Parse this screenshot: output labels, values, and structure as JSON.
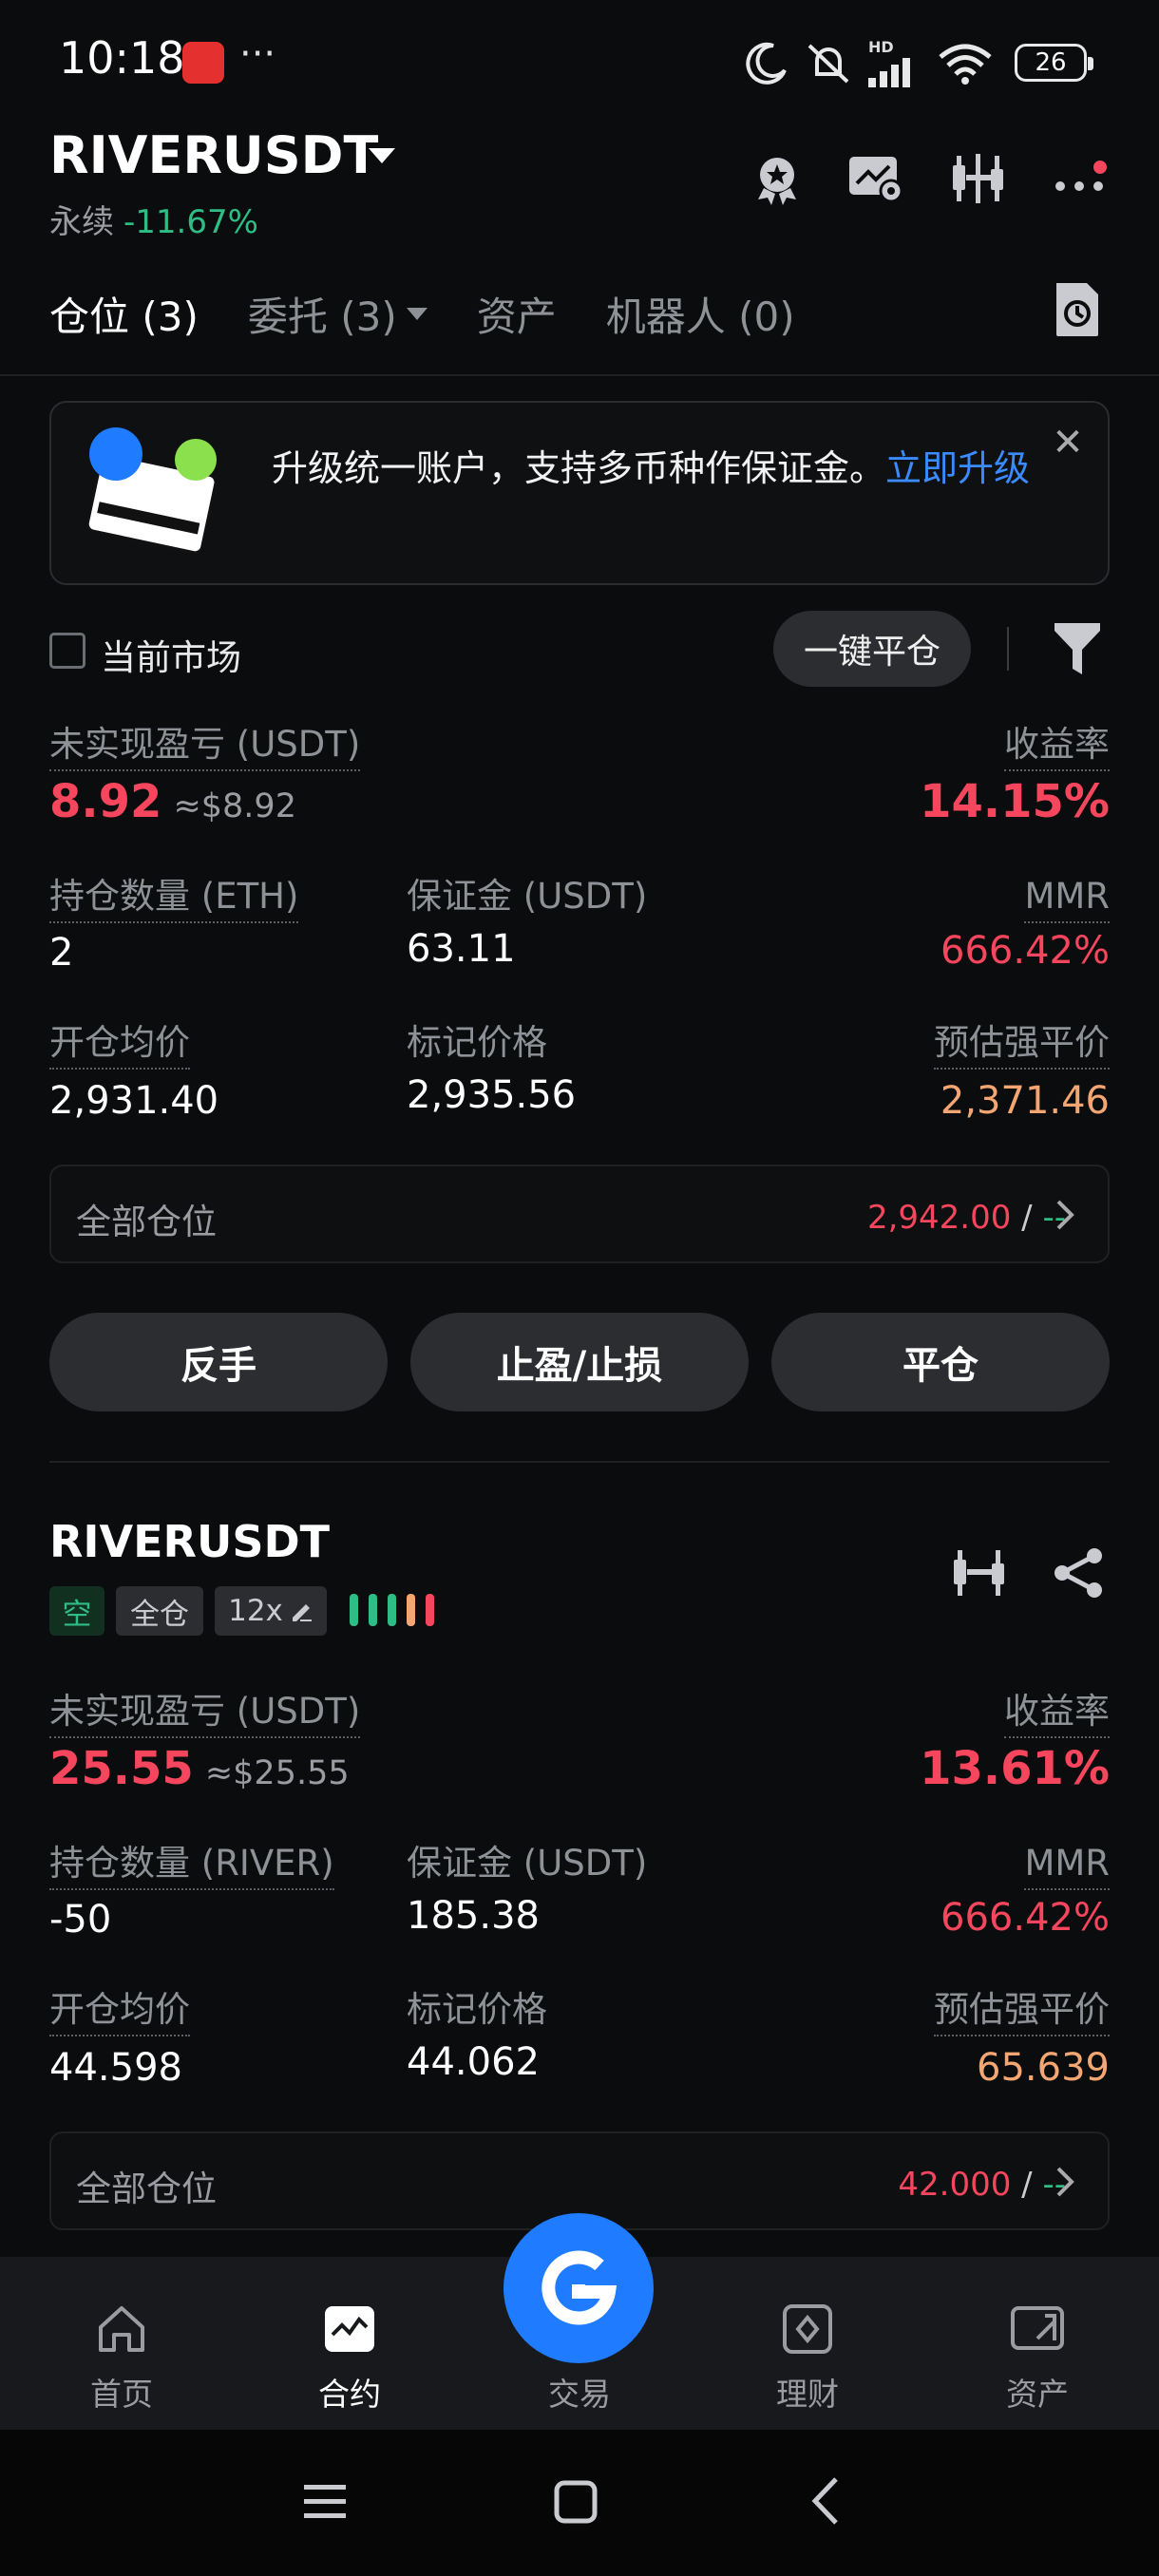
{
  "status_bar": {
    "time": "10:18",
    "more": "···",
    "battery": "26",
    "network": "HD"
  },
  "header": {
    "pair": "RIVERUSDT",
    "contract_type": "永续",
    "change": "-11.67%"
  },
  "tabs": [
    {
      "label": "仓位 (3)"
    },
    {
      "label": "委托 (3)"
    },
    {
      "label": "资产"
    },
    {
      "label": "机器人 (0)"
    }
  ],
  "banner": {
    "text": "升级统一账户，支持多币种作保证金。",
    "link": "立即升级",
    "close": "✕"
  },
  "filter": {
    "current_market_label": "当前市场",
    "close_all_label": "一键平仓"
  },
  "position1": {
    "pnl_label": "未实现盈亏 (USDT)",
    "pnl_value": "8.92",
    "pnl_approx": "≈$8.92",
    "roe_label": "收益率",
    "roe_value": "14.15%",
    "size_label": "持仓数量 (ETH)",
    "size_value": "2",
    "margin_label": "保证金 (USDT)",
    "margin_value": "63.11",
    "mmr_label": "MMR",
    "mmr_value": "666.42%",
    "entry_label": "开仓均价",
    "entry_value": "2,931.40",
    "mark_label": "标记价格",
    "mark_value": "2,935.56",
    "liq_label": "预估强平价",
    "liq_value": "2,371.46",
    "all_pos_label": "全部仓位",
    "all_pos_value": "2,942.00",
    "all_pos_slash": " / ",
    "all_pos_dash": "--"
  },
  "actions": {
    "reverse": "反手",
    "tpsl": "止盈/止损",
    "close": "平仓"
  },
  "position2": {
    "symbol": "RIVERUSDT",
    "side_tag": "空",
    "margin_mode_tag": "全仓",
    "leverage_tag": "12x",
    "pnl_label": "未实现盈亏 (USDT)",
    "pnl_value": "25.55",
    "pnl_approx": "≈$25.55",
    "roe_label": "收益率",
    "roe_value": "13.61%",
    "size_label": "持仓数量 (RIVER)",
    "size_value": "-50",
    "margin_label": "保证金 (USDT)",
    "margin_value": "185.38",
    "mmr_label": "MMR",
    "mmr_value": "666.42%",
    "entry_label": "开仓均价",
    "entry_value": "44.598",
    "mark_label": "标记价格",
    "mark_value": "44.062",
    "liq_label": "预估强平价",
    "liq_value": "65.639",
    "all_pos_label": "全部仓位",
    "all_pos_value": "42.000",
    "all_pos_slash": " / ",
    "all_pos_dash": "--"
  },
  "bottom_nav": [
    {
      "label": "首页",
      "icon": "home-icon"
    },
    {
      "label": "合约",
      "icon": "futures-icon"
    },
    {
      "label": "交易",
      "icon": "trade-icon"
    },
    {
      "label": "理财",
      "icon": "earn-icon"
    },
    {
      "label": "资产",
      "icon": "wallet-icon"
    }
  ],
  "colors": {
    "accent_blue": "#1f7bff",
    "red": "#f6465d",
    "green": "#2ebd85",
    "orange": "#f4a672",
    "background": "#0b0c0d"
  }
}
